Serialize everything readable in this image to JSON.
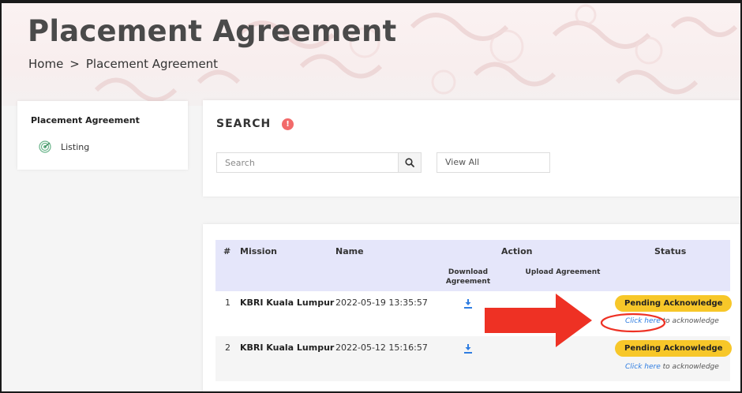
{
  "page": {
    "title": "Placement Agreement",
    "breadcrumb": [
      "Home",
      "Placement Agreement"
    ],
    "breadcrumb_separator": ">"
  },
  "sidebar": {
    "title": "Placement Agreement",
    "items": [
      {
        "label": "Listing",
        "icon": "radar-icon"
      }
    ]
  },
  "search": {
    "heading": "SEARCH",
    "info_icon": "!",
    "placeholder": "Search",
    "filter_value": "View All"
  },
  "table": {
    "headers": {
      "num": "#",
      "mission": "Mission",
      "name": "Name",
      "action": "Action",
      "download": "Download Agreement",
      "upload": "Upload Agreement",
      "status": "Status"
    },
    "rows": [
      {
        "num": "1",
        "mission": "KBRI Kuala Lumpur",
        "name": "2022-05-19 13:35:57",
        "status": "Pending Acknowledge",
        "ack_link": "Click here",
        "ack_rest": " to acknowledge"
      },
      {
        "num": "2",
        "mission": "KBRI Kuala Lumpur",
        "name": "2022-05-12 15:16:57",
        "status": "Pending Acknowledge",
        "ack_link": "Click here",
        "ack_rest": " to acknowledge"
      }
    ]
  },
  "colors": {
    "accent_header": "#e5e6fa",
    "badge": "#f7c729",
    "link": "#2f7de1",
    "annotation_red": "#ee3124"
  }
}
